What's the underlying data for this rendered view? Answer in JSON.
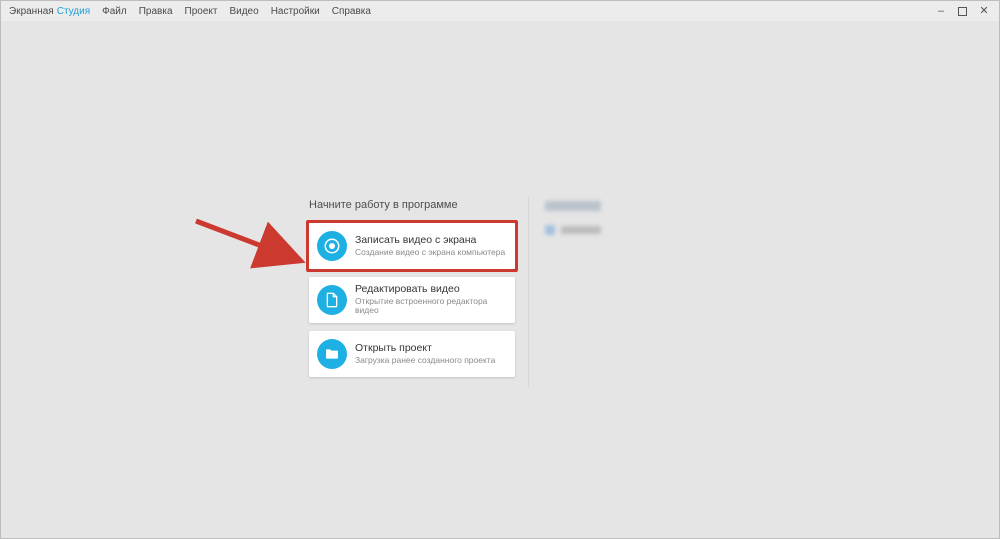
{
  "brand": {
    "part1": "Экранная",
    "part2": "Студия"
  },
  "menu": {
    "file": "Файл",
    "edit": "Правка",
    "project": "Проект",
    "video": "Видео",
    "settings": "Настройки",
    "help": "Справка"
  },
  "start": {
    "title": "Начните работу в программе",
    "cards": [
      {
        "title": "Записать видео с экрана",
        "subtitle": "Создание видео с экрана компьютера"
      },
      {
        "title": "Редактировать видео",
        "subtitle": "Открытие встроенного редактора видео"
      },
      {
        "title": "Открыть проект",
        "subtitle": "Загрузка ранее созданного проекта"
      }
    ]
  },
  "colors": {
    "accent": "#1fb0e3",
    "highlight": "#cc3a2f"
  }
}
